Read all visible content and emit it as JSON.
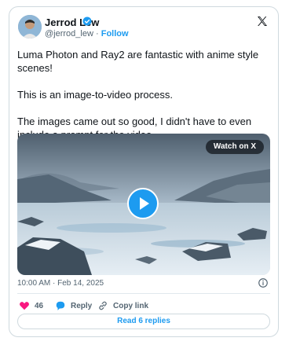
{
  "author": {
    "name": "Jerrod Lew",
    "handle": "@jerrod_lew",
    "separator": "·",
    "follow_label": "Follow"
  },
  "tweet": {
    "paragraphs": [
      "Luma Photon and Ray2 are fantastic with anime style scenes!",
      "This is an image-to-video process.",
      "The images came out so good, I didn't have to even include a prompt for the video."
    ]
  },
  "media": {
    "watch_label": "Watch on X",
    "play_icon": "play-icon"
  },
  "meta": {
    "timestamp": "10:00 AM · Feb 14, 2025",
    "info_icon": "info-icon"
  },
  "actions": {
    "like_count": "46",
    "reply_label": "Reply",
    "copy_link_label": "Copy link"
  },
  "footer": {
    "read_replies_label": "Read 6 replies"
  },
  "colors": {
    "accent": "#1d9bf0",
    "like": "#f91880",
    "text": "#0f1419",
    "muted": "#536471"
  }
}
